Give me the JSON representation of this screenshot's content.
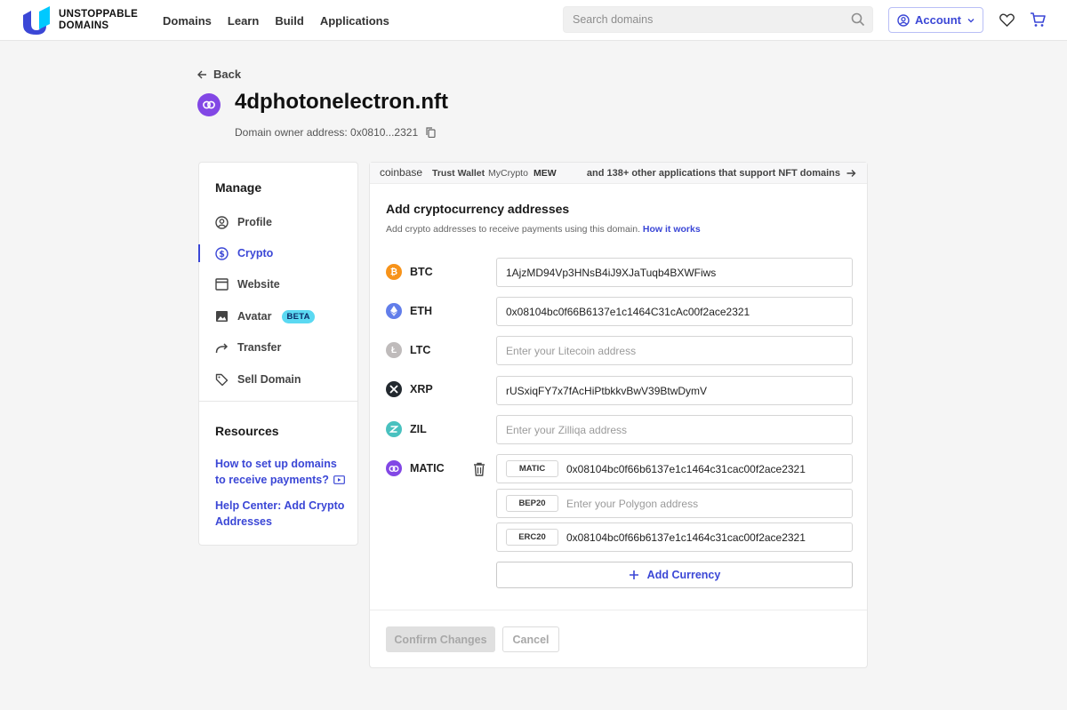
{
  "header": {
    "logo_line1": "UNSTOPPABLE",
    "logo_line2": "DOMAINS",
    "nav": [
      "Domains",
      "Learn",
      "Build",
      "Applications"
    ],
    "search_placeholder": "Search domains",
    "account_label": "Account",
    "icons": {
      "search": "search-icon",
      "account": "user-circle-icon",
      "chevron": "chevron-down-icon",
      "favorites": "heart-icon",
      "cart": "cart-icon"
    }
  },
  "page": {
    "back_label": "Back",
    "domain": "4dphotonelectron.nft",
    "owner_label": "Domain owner address: 0x0810...2321"
  },
  "sidebar": {
    "manage_heading": "Manage",
    "items": [
      {
        "label": "Profile",
        "icon": "user-circle-icon",
        "active": false
      },
      {
        "label": "Crypto",
        "icon": "dollar-circle-icon",
        "active": true
      },
      {
        "label": "Website",
        "icon": "browser-window-icon",
        "active": false
      },
      {
        "label": "Avatar",
        "icon": "image-icon",
        "active": false,
        "badge": "BETA"
      },
      {
        "label": "Transfer",
        "icon": "share-arrow-icon",
        "active": false
      },
      {
        "label": "Sell Domain",
        "icon": "tag-icon",
        "active": false
      }
    ],
    "resources_heading": "Resources",
    "resource_links": [
      {
        "label": "How to set up domains to receive payments?",
        "icon": "video-icon"
      },
      {
        "label": "Help Center: Add Crypto Addresses"
      }
    ]
  },
  "apps_strip": {
    "apps": [
      "coinbase",
      "Trust Wallet",
      "MyCrypto",
      "MEW"
    ],
    "more": "and 138+ other applications that support NFT domains"
  },
  "crypto": {
    "title": "Add cryptocurrency addresses",
    "subtitle": "Add crypto addresses to receive payments using this domain.",
    "how_it_works": "How it works",
    "coins": [
      {
        "symbol": "BTC",
        "value": "1AjzMD94Vp3HNsB4iJ9XJaTuqb4BXWFiws",
        "placeholder": "",
        "color": "#f7931a"
      },
      {
        "symbol": "ETH",
        "value": "0x08104bc0f66B6137e1c1464C31cAc00f2ace2321",
        "placeholder": "",
        "color": "#627eea"
      },
      {
        "symbol": "LTC",
        "value": "",
        "placeholder": "Enter your Litecoin address",
        "color": "#bfbbbb"
      },
      {
        "symbol": "XRP",
        "value": "rUSxiqFY7x7fAcHiPtbkkvBwV39BtwDymV",
        "placeholder": "",
        "color": "#23292f"
      },
      {
        "symbol": "ZIL",
        "value": "",
        "placeholder": "Enter your Zilliqa address",
        "color": "#49c1bf"
      }
    ],
    "matic": {
      "symbol": "MATIC",
      "color": "#8247e5",
      "versions": [
        {
          "tag": "MATIC",
          "value": "0x08104bc0f66b6137e1c1464c31cac00f2ace2321",
          "placeholder": ""
        },
        {
          "tag": "BEP20",
          "value": "",
          "placeholder": "Enter your Polygon address"
        },
        {
          "tag": "ERC20",
          "value": "0x08104bc0f66b6137e1c1464c31cac00f2ace2321",
          "placeholder": ""
        }
      ]
    },
    "add_currency_label": "Add Currency",
    "confirm_label": "Confirm Changes",
    "cancel_label": "Cancel"
  }
}
